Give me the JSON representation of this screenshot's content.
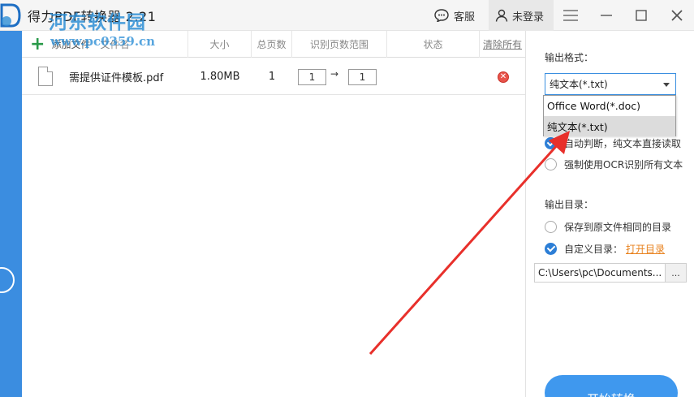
{
  "titlebar": {
    "title": "得力PDF转换器 2.21",
    "service_label": "客服",
    "login_label": "未登录"
  },
  "watermark": {
    "site_name": "河东软件园",
    "url": "www.pc0359.cn"
  },
  "toolbar": {
    "add_label": "添加文件",
    "add_label_extra": "文件名"
  },
  "table": {
    "headers": {
      "size": "大小",
      "pages": "总页数",
      "range": "识别页数范围",
      "status": "状态",
      "clear": "清除所有"
    },
    "rows": [
      {
        "name": "需提供证件模板.pdf",
        "size": "1.80MB",
        "pages": "1",
        "range_from": "1",
        "range_to": "1"
      }
    ]
  },
  "panel": {
    "format_label": "输出格式：",
    "format_selected": "纯文本(*.txt)",
    "format_options": [
      "Office Word(*.doc)",
      "纯文本(*.txt)"
    ],
    "ocr_auto": "自动判断，纯文本直接读取",
    "ocr_force": "强制使用OCR识别所有文本",
    "dir_label": "输出目录：",
    "dir_same": "保存到原文件相同的目录",
    "dir_custom": "自定义目录：",
    "open_dir": "打开目录",
    "path": "C:\\Users\\pc\\Documents...",
    "browse": "...",
    "start": "开始转换"
  },
  "colors": {
    "accent": "#3b8de0",
    "annotation": "#e8302b",
    "link": "#e8821e",
    "add_icon": "#2a9a4a"
  }
}
